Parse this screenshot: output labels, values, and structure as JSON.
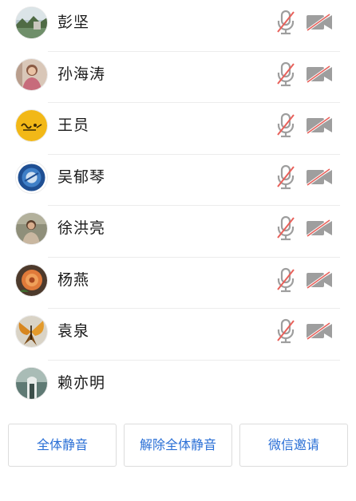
{
  "participants": [
    {
      "name": "彭坚",
      "avatar_icon": "landscape-photo-icon",
      "mic_muted": true,
      "camera_off": true
    },
    {
      "name": "孙海涛",
      "avatar_icon": "portrait-photo-icon",
      "mic_muted": true,
      "camera_off": true
    },
    {
      "name": "王员",
      "avatar_icon": "yellow-logo-icon",
      "mic_muted": true,
      "camera_off": true
    },
    {
      "name": "吴郁琴",
      "avatar_icon": "blue-emblem-icon",
      "mic_muted": true,
      "camera_off": true
    },
    {
      "name": "徐洪亮",
      "avatar_icon": "portrait-photo-icon",
      "mic_muted": true,
      "camera_off": true
    },
    {
      "name": "杨燕",
      "avatar_icon": "flower-photo-icon",
      "mic_muted": true,
      "camera_off": true
    },
    {
      "name": "袁泉",
      "avatar_icon": "butterfly-photo-icon",
      "mic_muted": true,
      "camera_off": true
    },
    {
      "name": "赖亦明",
      "avatar_icon": "landscape-photo-icon",
      "mic_muted": false,
      "camera_off": false
    }
  ],
  "actions": {
    "mute_all": "全体静音",
    "unmute_all": "解除全体静音",
    "wechat_invite": "微信邀请"
  },
  "colors": {
    "accent": "#2a6fd6",
    "icon_gray": "#9e9e9e",
    "muted_slash": "#e8605a"
  }
}
